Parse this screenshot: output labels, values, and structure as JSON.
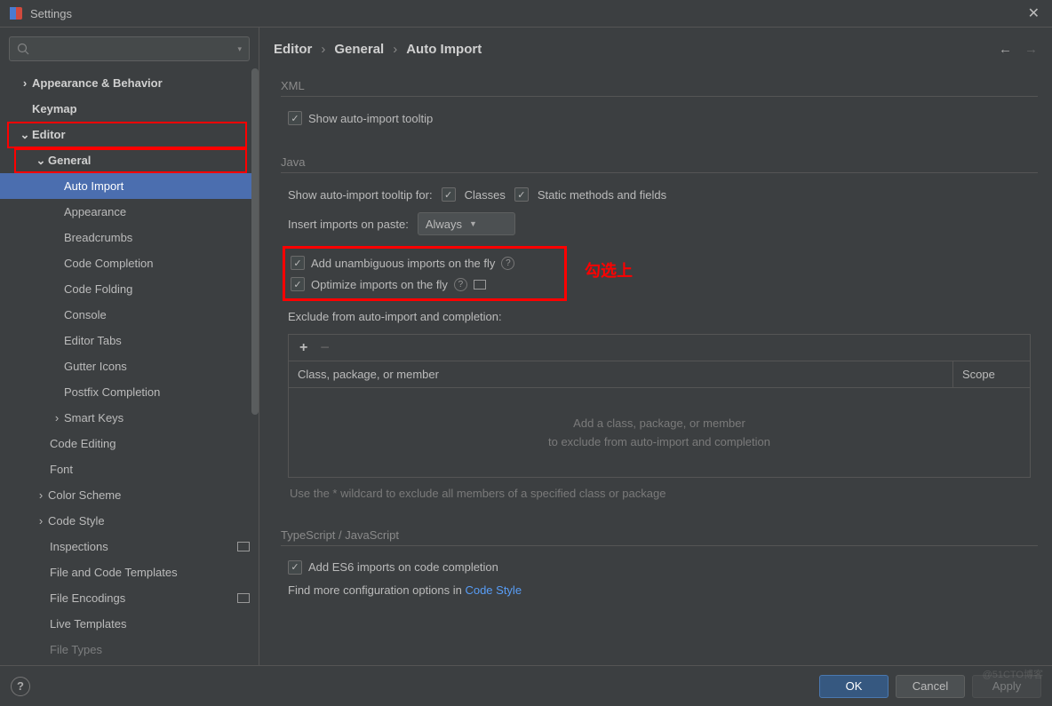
{
  "window": {
    "title": "Settings"
  },
  "breadcrumb": {
    "a": "Editor",
    "b": "General",
    "c": "Auto Import"
  },
  "sidebar": {
    "search_placeholder": "",
    "items": [
      {
        "label": "Appearance & Behavior"
      },
      {
        "label": "Keymap"
      },
      {
        "label": "Editor"
      },
      {
        "label": "General"
      },
      {
        "label": "Auto Import"
      },
      {
        "label": "Appearance"
      },
      {
        "label": "Breadcrumbs"
      },
      {
        "label": "Code Completion"
      },
      {
        "label": "Code Folding"
      },
      {
        "label": "Console"
      },
      {
        "label": "Editor Tabs"
      },
      {
        "label": "Gutter Icons"
      },
      {
        "label": "Postfix Completion"
      },
      {
        "label": "Smart Keys"
      },
      {
        "label": "Code Editing"
      },
      {
        "label": "Font"
      },
      {
        "label": "Color Scheme"
      },
      {
        "label": "Code Style"
      },
      {
        "label": "Inspections"
      },
      {
        "label": "File and Code Templates"
      },
      {
        "label": "File Encodings"
      },
      {
        "label": "Live Templates"
      },
      {
        "label": "File Types"
      }
    ]
  },
  "xml": {
    "title": "XML",
    "show_tooltip": "Show auto-import tooltip"
  },
  "java": {
    "title": "Java",
    "show_tooltip_for": "Show auto-import tooltip for:",
    "classes": "Classes",
    "static": "Static methods and fields",
    "insert_on_paste": "Insert imports on paste:",
    "paste_value": "Always",
    "add_unambiguous": "Add unambiguous imports on the fly",
    "optimize": "Optimize imports on the fly",
    "exclude_label": "Exclude from auto-import and completion:",
    "col1": "Class, package, or member",
    "col2": "Scope",
    "empty1": "Add a class, package, or member",
    "empty2": "to exclude from auto-import and completion",
    "hint": "Use the * wildcard to exclude all members of a specified class or package"
  },
  "ts": {
    "title": "TypeScript / JavaScript",
    "add_es6": "Add ES6 imports on code completion",
    "find_more": "Find more configuration options in ",
    "link": "Code Style"
  },
  "annotation": "勾选上",
  "footer": {
    "ok": "OK",
    "cancel": "Cancel",
    "apply": "Apply"
  },
  "watermark": "@51CTO博客"
}
